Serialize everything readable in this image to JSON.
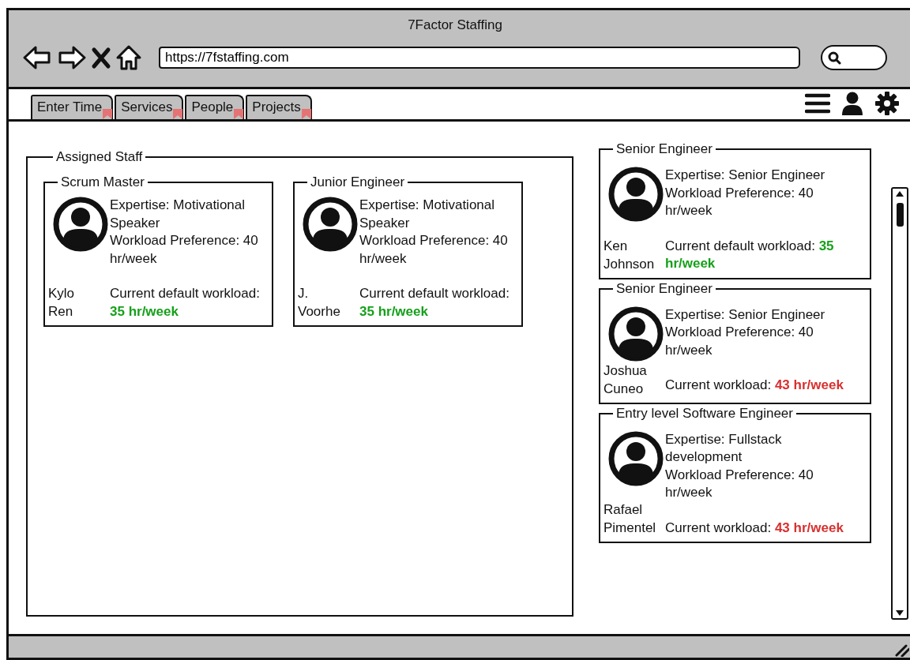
{
  "window": {
    "title": "7Factor Staffing"
  },
  "address_bar": {
    "value": "https://7fstaffing.com"
  },
  "tabs": [
    {
      "label": "Enter Time",
      "selected": false
    },
    {
      "label": "Services",
      "selected": false
    },
    {
      "label": "People",
      "selected": false
    },
    {
      "label": "Projects",
      "selected": false
    }
  ],
  "assigned_staff": {
    "title": "Assigned Staff",
    "cards": [
      {
        "role": "Scrum Master",
        "name": "Kylo Ren",
        "expertise": "Expertise: Motivational Speaker",
        "preference": "Workload Preference: 40 hr/week",
        "workload_label": "Current default workload:",
        "workload_value": "35 hr/week",
        "color": "#16a01a"
      },
      {
        "role": "Junior Engineer",
        "name": "J. Voorhe",
        "expertise": "Expertise: Motivational Speaker",
        "preference": "Workload Preference: 40 hr/week",
        "workload_label": "Current default workload:",
        "workload_value": "35 hr/week",
        "color": "#16a01a"
      }
    ]
  },
  "staff_list": [
    {
      "role": "Senior Engineer",
      "name": "Ken Johnson",
      "expertise": "Expertise: Senior Engineer",
      "preference": "Workload Preference: 40 hr/week",
      "workload_label": "Current default workload:",
      "workload_value": "35 hr/week",
      "color": "#16a01a"
    },
    {
      "role": "Senior Engineer",
      "name": "Joshua Cuneo",
      "expertise": "Expertise: Senior Engineer",
      "preference": "Workload Preference: 40 hr/week",
      "workload_label": "Current workload:",
      "workload_value": "43 hr/week",
      "color": "#d83030"
    },
    {
      "role": "Entry level Software Engineer",
      "name": "Rafael Pimentel",
      "expertise": "Expertise: Fullstack development",
      "preference": "Workload Preference: 40 hr/week",
      "workload_label": "Current workload:",
      "workload_value": "43 hr/week",
      "color": "#d83030"
    }
  ]
}
